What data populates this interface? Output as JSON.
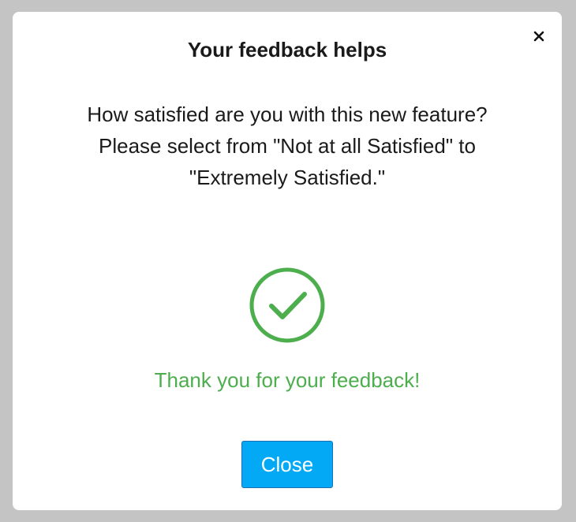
{
  "dialog": {
    "title": "Your feedback helps",
    "question_line1": "How satisfied are you with this new feature?",
    "question_line2": "Please select from \"Not at all Satisfied\" to",
    "question_line3": "\"Extremely Satisfied.\"",
    "thanks_message": "Thank you for your feedback!",
    "close_button_label": "Close",
    "close_icon": "close-icon",
    "success_icon": "checkmark-circle-icon"
  },
  "colors": {
    "success_green": "#4cae4c",
    "button_blue": "#03a9f4",
    "overlay_gray": "#c4c4c4"
  }
}
